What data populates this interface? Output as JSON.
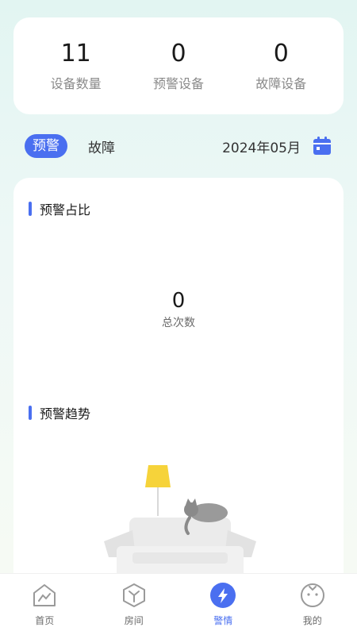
{
  "stats": [
    {
      "value": "11",
      "label": "设备数量"
    },
    {
      "value": "0",
      "label": "预警设备"
    },
    {
      "value": "0",
      "label": "故障设备"
    }
  ],
  "filter": {
    "tabs": [
      "预警",
      "故障"
    ],
    "active_tab": "预警",
    "month": "2024年05月"
  },
  "ratio_section": {
    "title": "预警占比",
    "total_value": "0",
    "total_label": "总次数"
  },
  "trend_section": {
    "title": "预警趋势"
  },
  "tabbar": {
    "items": [
      {
        "label": "首页",
        "icon": "home-icon"
      },
      {
        "label": "房间",
        "icon": "room-icon"
      },
      {
        "label": "警情",
        "icon": "alert-icon"
      },
      {
        "label": "我的",
        "icon": "profile-icon"
      }
    ],
    "active": "警情"
  },
  "colors": {
    "accent": "#4a6ff0",
    "lamp": "#f6d33a"
  }
}
